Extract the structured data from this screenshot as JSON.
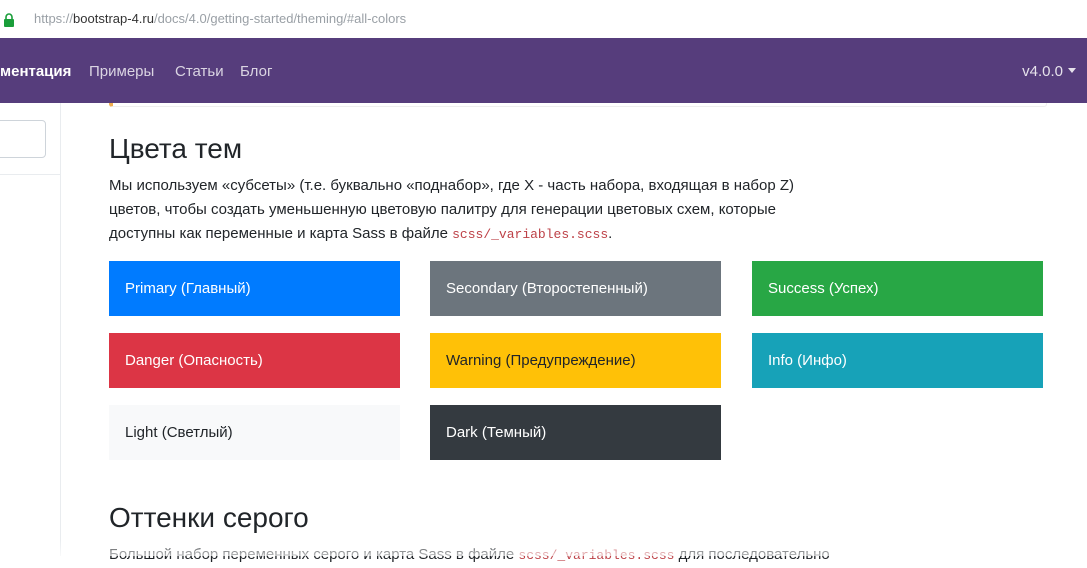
{
  "browser": {
    "url_host": "bootstrap-4.ru",
    "url_path": "/docs/4.0/getting-started/theming/#all-colors",
    "url_prefix": "https://"
  },
  "navbar": {
    "items": [
      {
        "label": "ментация",
        "active": true
      },
      {
        "label": "Примеры",
        "active": false
      },
      {
        "label": "Статьи",
        "active": false
      },
      {
        "label": "Блог",
        "active": false
      }
    ],
    "version": "v4.0.0",
    "bg_color": "#563d7c"
  },
  "section_theme_colors": {
    "title": "Цвета тем",
    "para_line1": "Мы используем «субсеты» (т.е. буквально «поднабор», где X - часть набора, входящая в набор Z)",
    "para_line2": "цветов, чтобы создать уменьшенную цветовую палитру для генерации цветовых схем, которые",
    "para_line3_text": "доступны как переменные и карта Sass в файле ",
    "para_line3_code": "scss/_variables.scss",
    "para_line3_end": "."
  },
  "swatches": [
    {
      "label": "Primary (Главный)",
      "color": "#007bff",
      "text_color": "#ffffff"
    },
    {
      "label": "Secondary (Второстепенный)",
      "color": "#6c757d",
      "text_color": "#ffffff"
    },
    {
      "label": "Success (Успех)",
      "color": "#28a745",
      "text_color": "#ffffff"
    },
    {
      "label": "Danger (Опасность)",
      "color": "#dc3545",
      "text_color": "#ffffff"
    },
    {
      "label": "Warning (Предупреждение)",
      "color": "#ffc107",
      "text_color": "#212529"
    },
    {
      "label": "Info (Инфо)",
      "color": "#17a2b8",
      "text_color": "#ffffff"
    },
    {
      "label": "Light (Светлый)",
      "color": "#f8f9fa",
      "text_color": "#212529"
    },
    {
      "label": "Dark (Темный)",
      "color": "#343a40",
      "text_color": "#ffffff"
    }
  ],
  "section_grays": {
    "title": "Оттенки серого",
    "para_text": "Большой набор переменных серого и карта Sass в файле ",
    "para_code": "scss/_variables.scss",
    "para_end": " для последовательно"
  }
}
